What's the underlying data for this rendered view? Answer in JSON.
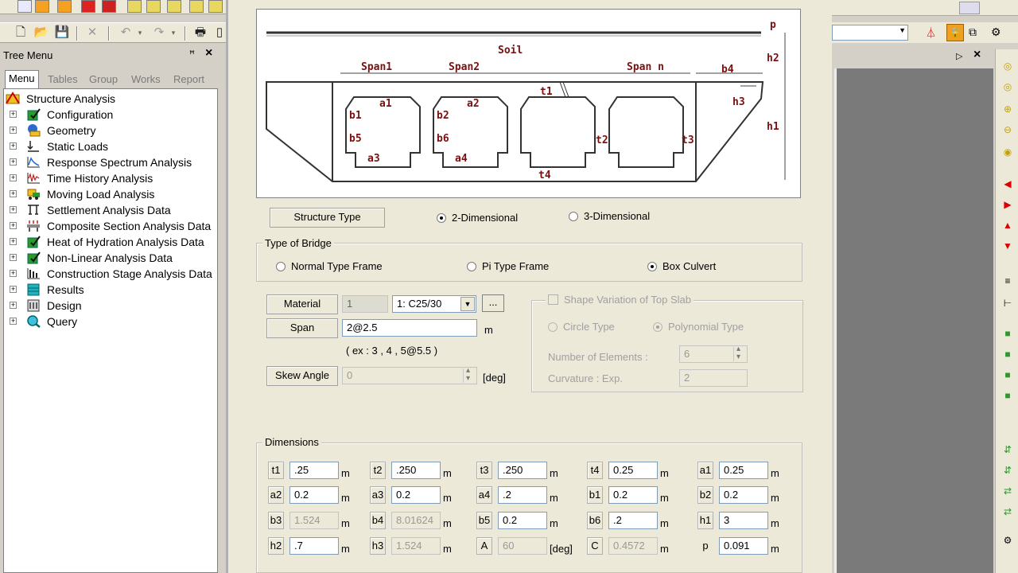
{
  "tree_menu": {
    "title": "Tree Menu",
    "pin_icon": "pin-icon",
    "close_glyph": "×",
    "tabs": [
      "Menu",
      "Tables",
      "Group",
      "Works",
      "Report"
    ],
    "root": "Structure Analysis",
    "items": [
      "Configuration",
      "Geometry",
      "Static Loads",
      "Response Spectrum Analysis",
      "Time History Analysis",
      "Moving Load Analysis",
      "Settlement Analysis Data",
      "Composite Section Analysis Data",
      "Heat of Hydration Analysis Data",
      "Non-Linear Analysis Data",
      "Construction Stage Analysis Data",
      "Results",
      "Design",
      "Query"
    ]
  },
  "diagram": {
    "soil": "Soil",
    "span1": "Span1",
    "span2": "Span2",
    "spann": "Span n",
    "p": "p",
    "h2": "h2",
    "h1": "h1",
    "h3": "h3",
    "b4": "b4",
    "t1": "t1",
    "t2": "t2",
    "t3": "t3",
    "t4": "t4",
    "a1": "a1",
    "a2": "a2",
    "a3": "a3",
    "a4": "a4",
    "b1": "b1",
    "b2": "b2",
    "b5": "b5",
    "b6": "b6"
  },
  "structure_type": {
    "label": "Structure Type",
    "options": [
      "2-Dimensional",
      "3-Dimensional"
    ],
    "selected": "2-Dimensional"
  },
  "bridge_type": {
    "title": "Type of Bridge",
    "options": [
      "Normal Type Frame",
      "Pi Type Frame",
      "Box Culvert"
    ],
    "selected": "Box Culvert"
  },
  "material": {
    "label": "Material",
    "id": "1",
    "selected": "1: C25/30",
    "more_button": "..."
  },
  "span": {
    "label": "Span",
    "value": "2@2.5",
    "unit": "m",
    "example": "( ex : 3 , 4 , 5@5.5 )"
  },
  "skew": {
    "label": "Skew Angle",
    "value": "0",
    "unit": "[deg]"
  },
  "shape_variation": {
    "checkbox_label": "Shape Variation of Top Slab",
    "options": [
      "Circle Type",
      "Polynomial Type"
    ],
    "selected": "Polynomial Type",
    "num_elements_label": "Number of Elements :",
    "num_elements_value": "6",
    "curvature_label": "Curvature : Exp.",
    "curvature_value": "2"
  },
  "dimensions": {
    "title": "Dimensions",
    "rows": [
      [
        {
          "label": "t1",
          "value": ".25",
          "unit": "m"
        },
        {
          "label": "t2",
          "value": ".250",
          "unit": "m"
        },
        {
          "label": "t3",
          "value": ".250",
          "unit": "m"
        },
        {
          "label": "t4",
          "value": "0.25",
          "unit": "m"
        },
        {
          "label": "a1",
          "value": "0.25",
          "unit": "m"
        }
      ],
      [
        {
          "label": "a2",
          "value": "0.2",
          "unit": "m"
        },
        {
          "label": "a3",
          "value": "0.2",
          "unit": "m"
        },
        {
          "label": "a4",
          "value": ".2",
          "unit": "m"
        },
        {
          "label": "b1",
          "value": "0.2",
          "unit": "m"
        },
        {
          "label": "b2",
          "value": "0.2",
          "unit": "m"
        }
      ],
      [
        {
          "label": "b3",
          "value": "1.524",
          "unit": "m"
        },
        {
          "label": "b4",
          "value": "8.01624",
          "unit": "m"
        },
        {
          "label": "b5",
          "value": "0.2",
          "unit": "m"
        },
        {
          "label": "b6",
          "value": ".2",
          "unit": "m"
        },
        {
          "label": "h1",
          "value": "3",
          "unit": "m"
        }
      ],
      [
        {
          "label": "h2",
          "value": ".7",
          "unit": "m"
        },
        {
          "label": "h3",
          "value": "1.524",
          "unit": "m"
        },
        {
          "label": "A",
          "value": "60",
          "unit": "[deg]"
        },
        {
          "label": "C",
          "value": "0.4572",
          "unit": "m"
        },
        {
          "label": "p",
          "value": "0.091",
          "unit": "m"
        }
      ]
    ]
  },
  "colors": {
    "dialog_bg": "#ece9d8",
    "app_bg": "#d4d0c8",
    "canvas_bg": "#7a7a7a",
    "diagram_text": "#7a1010"
  }
}
